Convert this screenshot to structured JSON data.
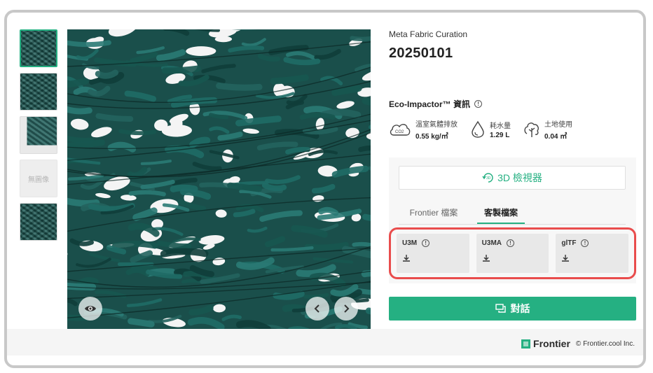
{
  "thumbnails": [
    {
      "kind": "fabric",
      "active": true
    },
    {
      "kind": "fabric",
      "active": false
    },
    {
      "kind": "mixed",
      "active": false
    },
    {
      "kind": "none",
      "label": "無圖像"
    },
    {
      "kind": "fabric",
      "active": false
    }
  ],
  "product": {
    "subtitle": "Meta Fabric Curation",
    "title": "20250101"
  },
  "eco": {
    "heading": "Eco-Impactor™ 資訊",
    "metrics": [
      {
        "icon": "cloud-co2-icon",
        "label": "溫室氣體排放",
        "value": "0.55 kg/㎡"
      },
      {
        "icon": "water-drop-icon",
        "label": "耗水量",
        "value": "1.29 L"
      },
      {
        "icon": "land-leaf-icon",
        "label": "土地使用",
        "value": "0.04 ㎡"
      }
    ]
  },
  "viewer": {
    "label": "3D 檢視器",
    "icon": "3d-rotate-icon"
  },
  "tabs": [
    {
      "label": "Frontier 檔案",
      "active": false
    },
    {
      "label": "客製檔案",
      "active": true
    }
  ],
  "downloads": [
    {
      "format": "U3M"
    },
    {
      "format": "U3MA"
    },
    {
      "format": "glTF"
    }
  ],
  "chat": {
    "label": "對話"
  },
  "footer": {
    "brand": "Frontier",
    "copyright": "© Frontier.cool Inc."
  },
  "colors": {
    "accent": "#25b082",
    "highlight": "#e94c4c",
    "fabric": "#1d5b56"
  }
}
